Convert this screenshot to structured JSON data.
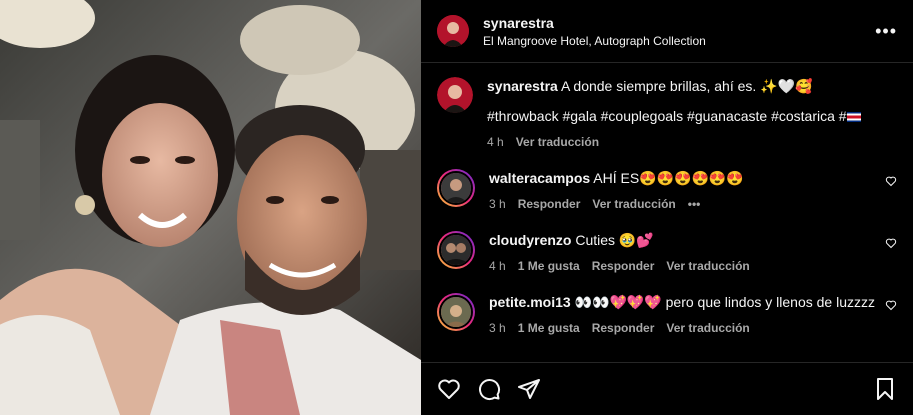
{
  "post": {
    "username": "synarestra",
    "location": "El Mangroove Hotel, Autograph Collection",
    "caption_user": "synarestra",
    "caption_text": "A donde siempre brillas, ahí es. ✨🤍🥰",
    "hashtags": "#throwback #gala #couplegoals #guanacaste #costarica #",
    "caption_time": "4 h",
    "caption_translate": "Ver traducción"
  },
  "comments": [
    {
      "user": "walteracampos",
      "text": "AHÍ ES😍😍😍😍😍😍",
      "time": "3 h",
      "reply": "Responder",
      "translate": "Ver traducción",
      "more": "•••"
    },
    {
      "user": "cloudyrenzo",
      "text": "Cuties 🥹💕",
      "time": "4 h",
      "likes": "1 Me gusta",
      "reply": "Responder",
      "translate": "Ver traducción"
    },
    {
      "user": "petite.moi13",
      "text": "👀👀💖💖💖  pero que lindos y llenos de luzzzz",
      "time": "3 h",
      "likes": "1 Me gusta",
      "reply": "Responder",
      "translate": "Ver traducción"
    }
  ],
  "header": {
    "more": "•••"
  }
}
